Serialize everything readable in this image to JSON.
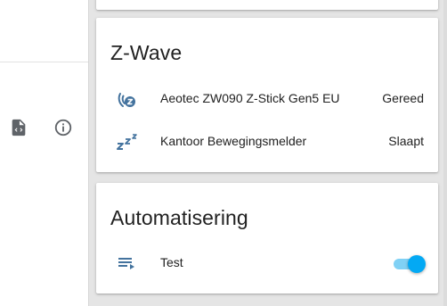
{
  "theme": {
    "icon_color": "#44739e",
    "accent": "#03a9f4",
    "accent_track": "#80d1f5"
  },
  "left_panel": {
    "icons": [
      "code-file-icon",
      "info-icon"
    ]
  },
  "zwave_card": {
    "title": "Z-Wave",
    "rows": [
      {
        "icon": "zwave-signal-icon",
        "name": "Aeotec ZW090 Z-Stick Gen5 EU",
        "state": "Gereed"
      },
      {
        "icon": "sleep-zzz-icon",
        "name": "Kantoor Bewegingsmelder",
        "state": "Slaapt"
      }
    ]
  },
  "automation_card": {
    "title": "Automatisering",
    "rows": [
      {
        "icon": "playlist-play-icon",
        "name": "Test",
        "enabled": true
      }
    ]
  }
}
